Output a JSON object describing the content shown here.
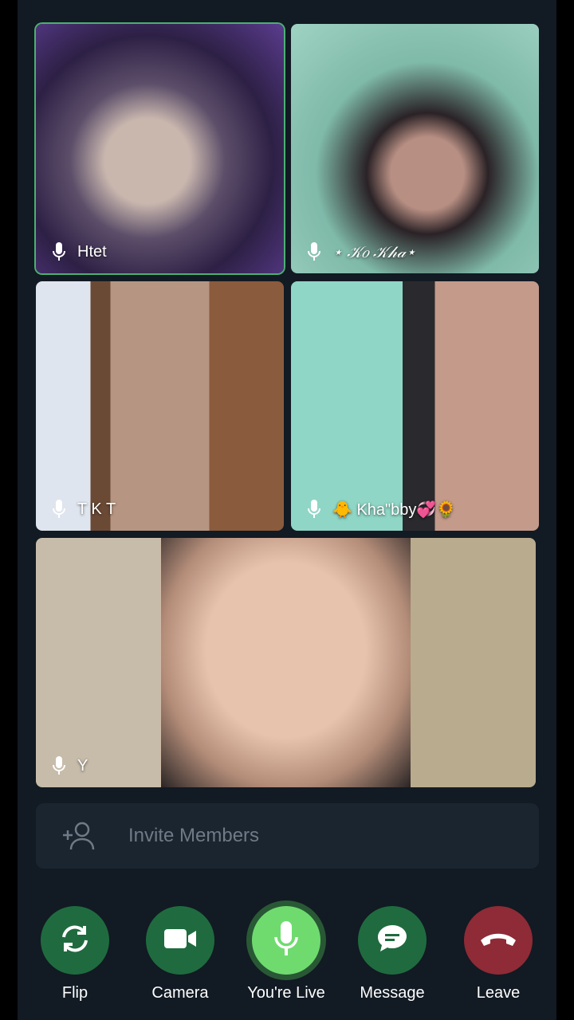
{
  "participants": [
    {
      "name": "Htet"
    },
    {
      "name": "⋆ 𝒦𝑜 𝒦𝒽𝒶⋆"
    },
    {
      "name": "T K T"
    },
    {
      "name": "🐥 Kha\"bby💞🌻"
    },
    {
      "name": "Y"
    }
  ],
  "invite": {
    "label": "Invite Members"
  },
  "controls": {
    "flip": "Flip",
    "camera": "Camera",
    "mic": "You're Live",
    "message": "Message",
    "leave": "Leave"
  },
  "colors": {
    "background": "#121a23",
    "button_green": "#1f6b3f",
    "mic_live": "#6fdb6f",
    "leave_red": "#8e2b36",
    "speaking_border": "#4caf73"
  }
}
